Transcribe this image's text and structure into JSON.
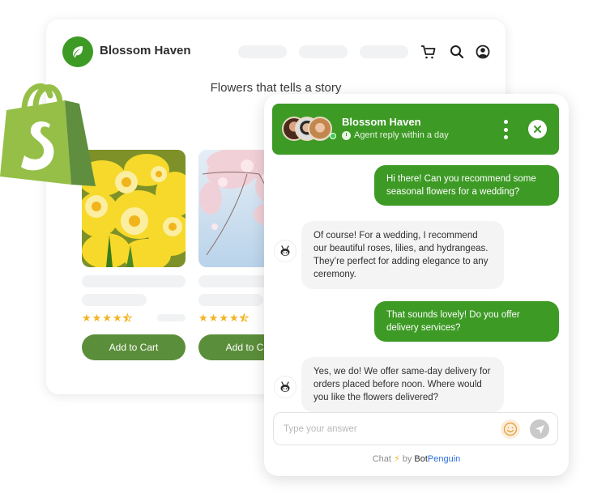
{
  "store": {
    "brand_name": "Blossom Haven",
    "tagline": "Flowers  that tells a story",
    "nav_placeholders": 3,
    "icons": [
      "cart-icon",
      "search-icon",
      "account-icon"
    ],
    "products": [
      {
        "image": "yellow-daffodils",
        "rating": 4.5,
        "button_label": "Add to Cart"
      },
      {
        "image": "cherry-blossoms",
        "rating": 4.5,
        "button_label": "Add to Cart"
      }
    ]
  },
  "chat": {
    "title": "Blossom Haven",
    "subtitle": "Agent reply within a day",
    "agent_status": "online",
    "messages": [
      {
        "from": "user",
        "text": "Hi there! Can you recommend some seasonal flowers for a wedding?"
      },
      {
        "from": "bot",
        "text": "Of course! For a wedding, I recommend our beautiful roses, lilies, and hydrangeas. They’re perfect for adding elegance to any ceremony."
      },
      {
        "from": "user",
        "text": "That sounds lovely! Do you offer delivery services?"
      },
      {
        "from": "bot",
        "text": "Yes, we do! We offer same-day delivery for orders placed before noon. Where would you like the flowers delivered?"
      }
    ],
    "input": {
      "value": "",
      "placeholder": "Type your answer"
    },
    "footer": {
      "prefix": "Chat",
      "by": "by",
      "brand_part1": "Bot",
      "brand_part2": "Penguin"
    }
  },
  "colors": {
    "brand_green": "#3d9a25",
    "button_green": "#5b8e3a",
    "star": "#f4b320",
    "link_blue": "#2f6fde",
    "shopify_light": "#95bf47",
    "shopify_dark": "#5e8e3e"
  }
}
